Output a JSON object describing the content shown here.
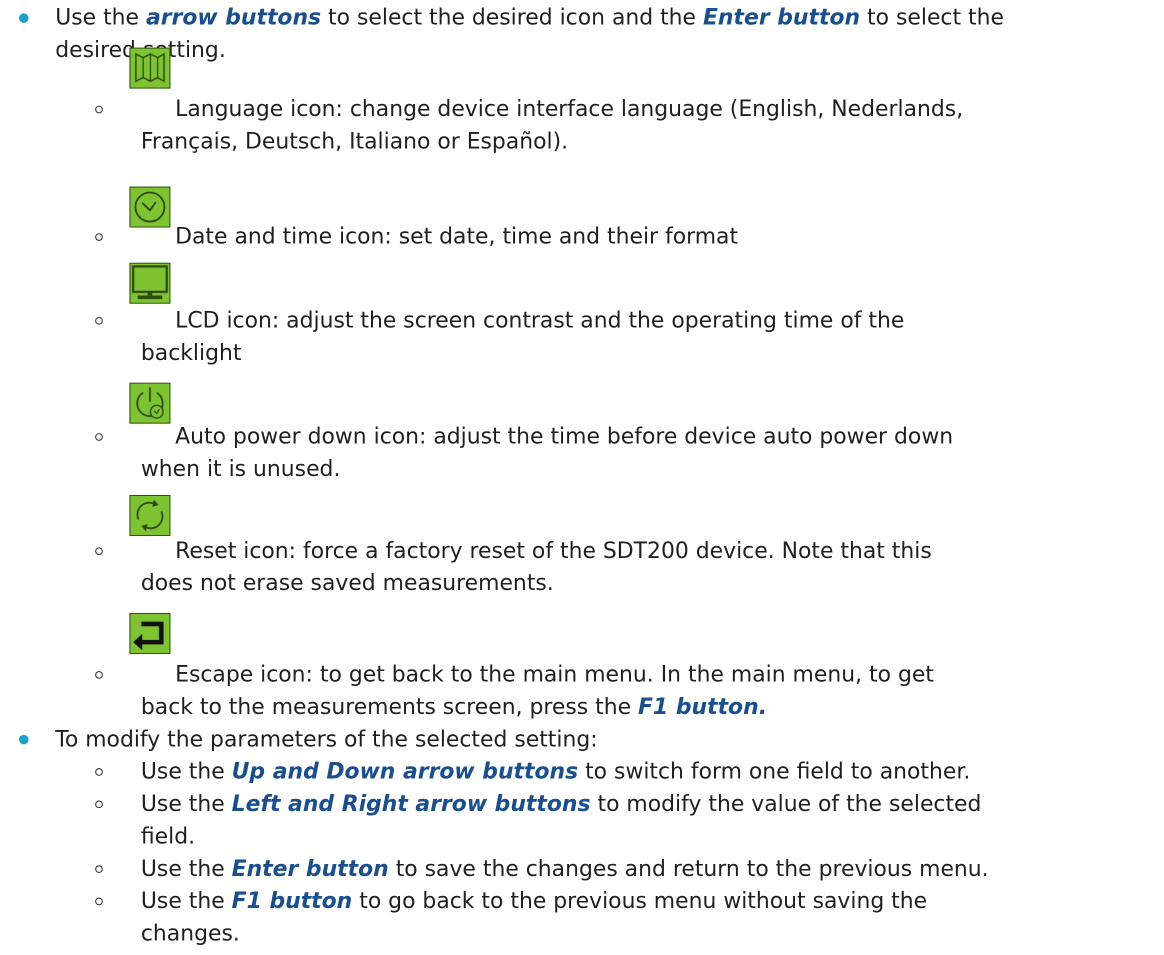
{
  "bullet1": {
    "pre": "Use the ",
    "hl1": "arrow buttons",
    "mid": " to select the desired icon and the ",
    "hl2": "Enter button",
    "post": " to select the",
    "line2": "desired setting."
  },
  "icons": [
    {
      "name": "language-icon",
      "line1": "Language icon: change device interface language (English, Nederlands,",
      "line2": "Français, Deutsch, Italiano or Español)."
    },
    {
      "name": "clock-icon",
      "line1": "Date and time icon: set date, time and their format"
    },
    {
      "name": "monitor-icon",
      "line1": "LCD icon: adjust the screen contrast and the operating time of the",
      "line2": "backlight"
    },
    {
      "name": "power-icon",
      "line1": "Auto power down icon: adjust the time before device auto power down",
      "line2": "when it is unused."
    },
    {
      "name": "reset-icon",
      "line1": "Reset icon: force a factory reset of the SDT200 device. Note that this",
      "line2": "does not erase saved measurements."
    },
    {
      "name": "escape-icon",
      "line1": "Escape icon: to get back to the main menu. In the main menu, to get",
      "line2pre": "back to the measurements screen, press the ",
      "line2hl": "F1 button."
    }
  ],
  "bullet2": {
    "text": "To modify the parameters of the selected setting:"
  },
  "sub": [
    {
      "pre": "Use the ",
      "hl": "Up and Down arrow buttons",
      "post": " to switch form one field to another."
    },
    {
      "pre": "Use the ",
      "hl": "Left and Right arrow buttons",
      "post": " to modify the value of the selected",
      "line2": "field."
    },
    {
      "pre": "Use the ",
      "hl": "Enter button",
      "post": " to save the changes and return to the previous menu."
    },
    {
      "pre": "Use the ",
      "hl": "F1 button",
      "post": " to go back to the previous menu without saving the",
      "line2": "changes."
    }
  ],
  "colors": {
    "accent_text": "#1a4f8f",
    "bullet": "#19a0d3",
    "icon_fill": "#7ec432"
  }
}
